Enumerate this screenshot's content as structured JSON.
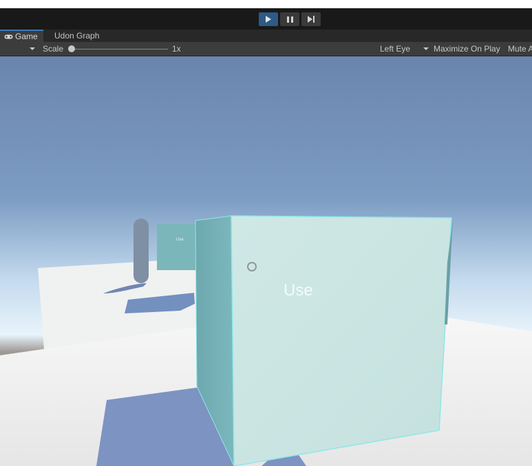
{
  "tabs": [
    {
      "label": "Game",
      "icon": "gamepad-icon",
      "active": true
    },
    {
      "label": "Udon Graph",
      "active": false
    }
  ],
  "toolbar": {
    "scale_label": "Scale",
    "scale_value": "1x",
    "eye_select": "Left Eye",
    "maximize_label": "Maximize On Play",
    "mute_label": "Mute A"
  },
  "playbar": {
    "play_active": true,
    "controls": [
      "play-icon",
      "pause-icon",
      "step-icon"
    ]
  },
  "scene": {
    "big_cube_label": "Use",
    "small_cube_label": "Use",
    "colors": {
      "sky_top": "#6a85ad",
      "horizon": "#e8f4fb",
      "ground": "#f3f3f3",
      "cube_front": "#cce6e4",
      "cube_side": "#72b0b6",
      "outline": "#8ee7e9"
    }
  }
}
